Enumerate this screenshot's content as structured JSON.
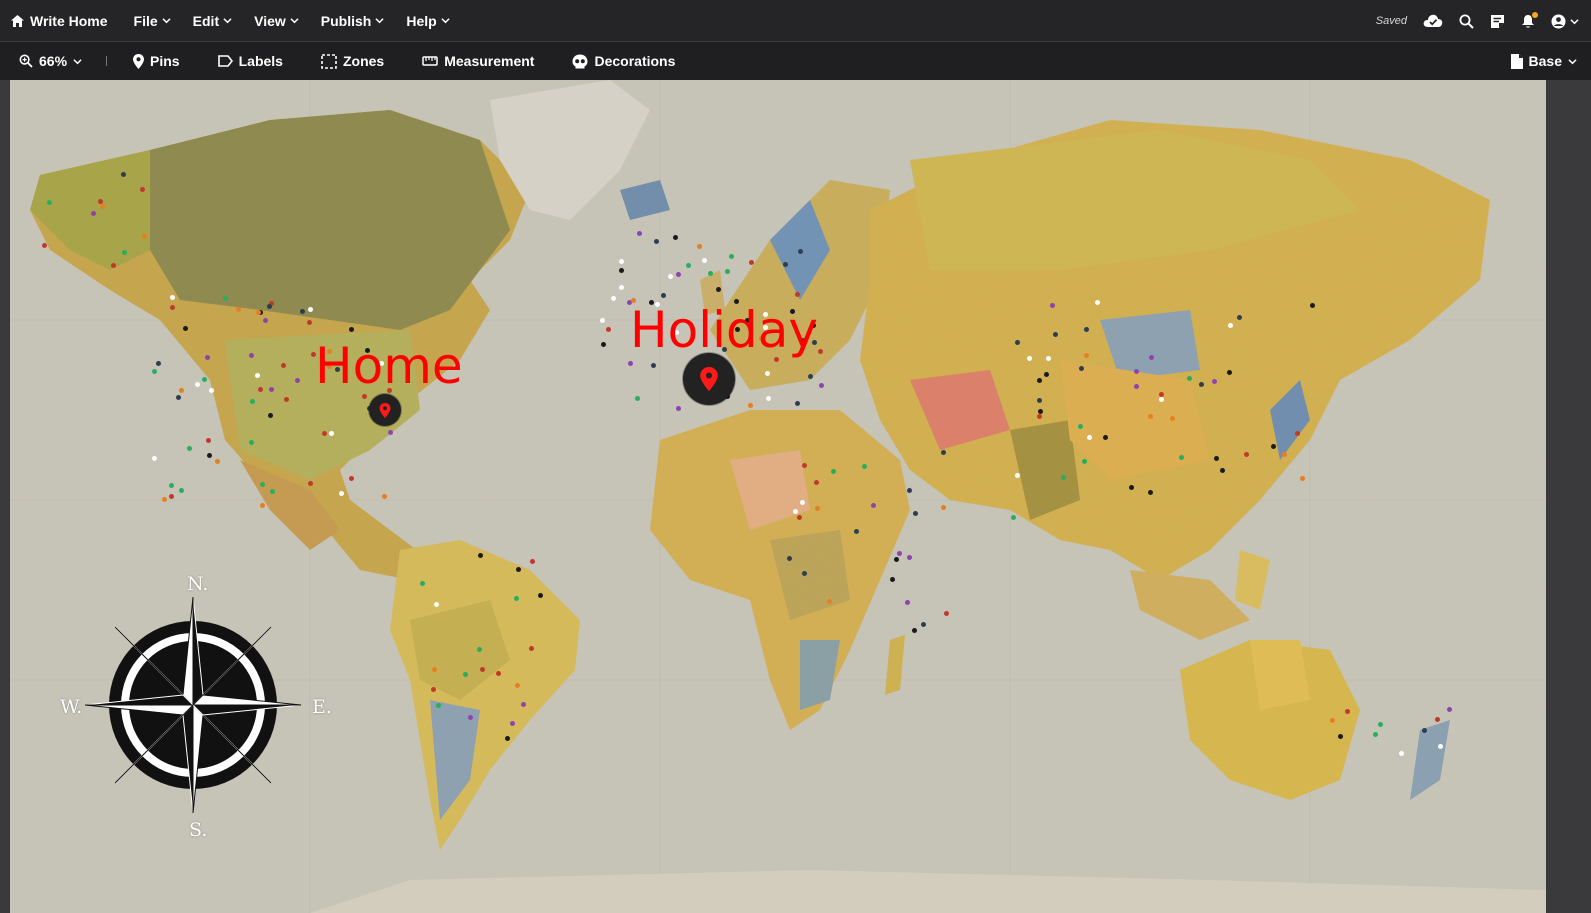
{
  "topbar": {
    "home_label": "Write Home",
    "menus": [
      "File",
      "Edit",
      "View",
      "Publish",
      "Help"
    ],
    "saved_label": "Saved"
  },
  "toolbar": {
    "zoom_label": "66%",
    "tools": [
      {
        "label": "Pins",
        "icon": "map-pin-icon"
      },
      {
        "label": "Labels",
        "icon": "label-icon"
      },
      {
        "label": "Zones",
        "icon": "zone-icon"
      },
      {
        "label": "Measurement",
        "icon": "ruler-icon"
      },
      {
        "label": "Decorations",
        "icon": "decorations-icon"
      }
    ],
    "layer_label": "Base"
  },
  "map": {
    "labels": {
      "home": "Home",
      "holiday": "Holiday"
    },
    "compass": {
      "north": "N.",
      "south": "S.",
      "east": "E.",
      "west": "W."
    },
    "label_color": "#ff0000",
    "pin_color": "#ff1a1a"
  }
}
